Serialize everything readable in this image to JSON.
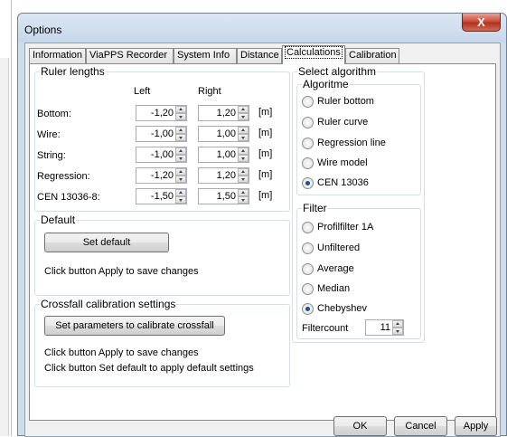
{
  "window": {
    "title": "Options",
    "close_glyph": "X"
  },
  "tabs": [
    {
      "label": "Information"
    },
    {
      "label": "ViaPPS Recorder"
    },
    {
      "label": "System Info"
    },
    {
      "label": "Distance"
    },
    {
      "label": "Calculations"
    },
    {
      "label": "Calibration"
    }
  ],
  "active_tab": "Calculations",
  "ruler_lengths": {
    "title": "Ruler lengths",
    "col_left": "Left",
    "col_right": "Right",
    "unit": "[m]",
    "rows": [
      {
        "label": "Bottom:",
        "left": "-1,20",
        "right": "1,20"
      },
      {
        "label": "Wire:",
        "left": "-1,00",
        "right": "1,00"
      },
      {
        "label": "String:",
        "left": "-1,00",
        "right": "1,00"
      },
      {
        "label": "Regression:",
        "left": "-1,20",
        "right": "1,20"
      },
      {
        "label": "CEN 13036-8:",
        "left": "-1,50",
        "right": "1,50"
      }
    ]
  },
  "default_group": {
    "title": "Default",
    "button": "Set default",
    "note": "Click button Apply to save changes"
  },
  "crossfall_group": {
    "title": "Crossfall calibration settings",
    "button": "Set parameters to calibrate crossfall",
    "note1": "Click button Apply to save changes",
    "note2": "Click button Set default to apply default settings"
  },
  "select_algorithm": {
    "title": "Select algorithm",
    "algoritme": {
      "title": "Algoritme",
      "options": [
        {
          "label": "Ruler bottom",
          "checked": false
        },
        {
          "label": "Ruler curve",
          "checked": false
        },
        {
          "label": "Regression line",
          "checked": false
        },
        {
          "label": "Wire model",
          "checked": false
        },
        {
          "label": "CEN 13036",
          "checked": true
        }
      ]
    },
    "filter": {
      "title": "Filter",
      "options": [
        {
          "label": "Profilfilter 1A",
          "checked": false
        },
        {
          "label": "Unfiltered",
          "checked": false
        },
        {
          "label": "Average",
          "checked": false
        },
        {
          "label": "Median",
          "checked": false
        },
        {
          "label": "Chebyshev",
          "checked": true
        }
      ],
      "filtercount_label": "Filtercount",
      "filtercount_value": "11"
    }
  },
  "buttons": {
    "ok": "OK",
    "cancel": "Cancel",
    "apply": "Apply"
  }
}
